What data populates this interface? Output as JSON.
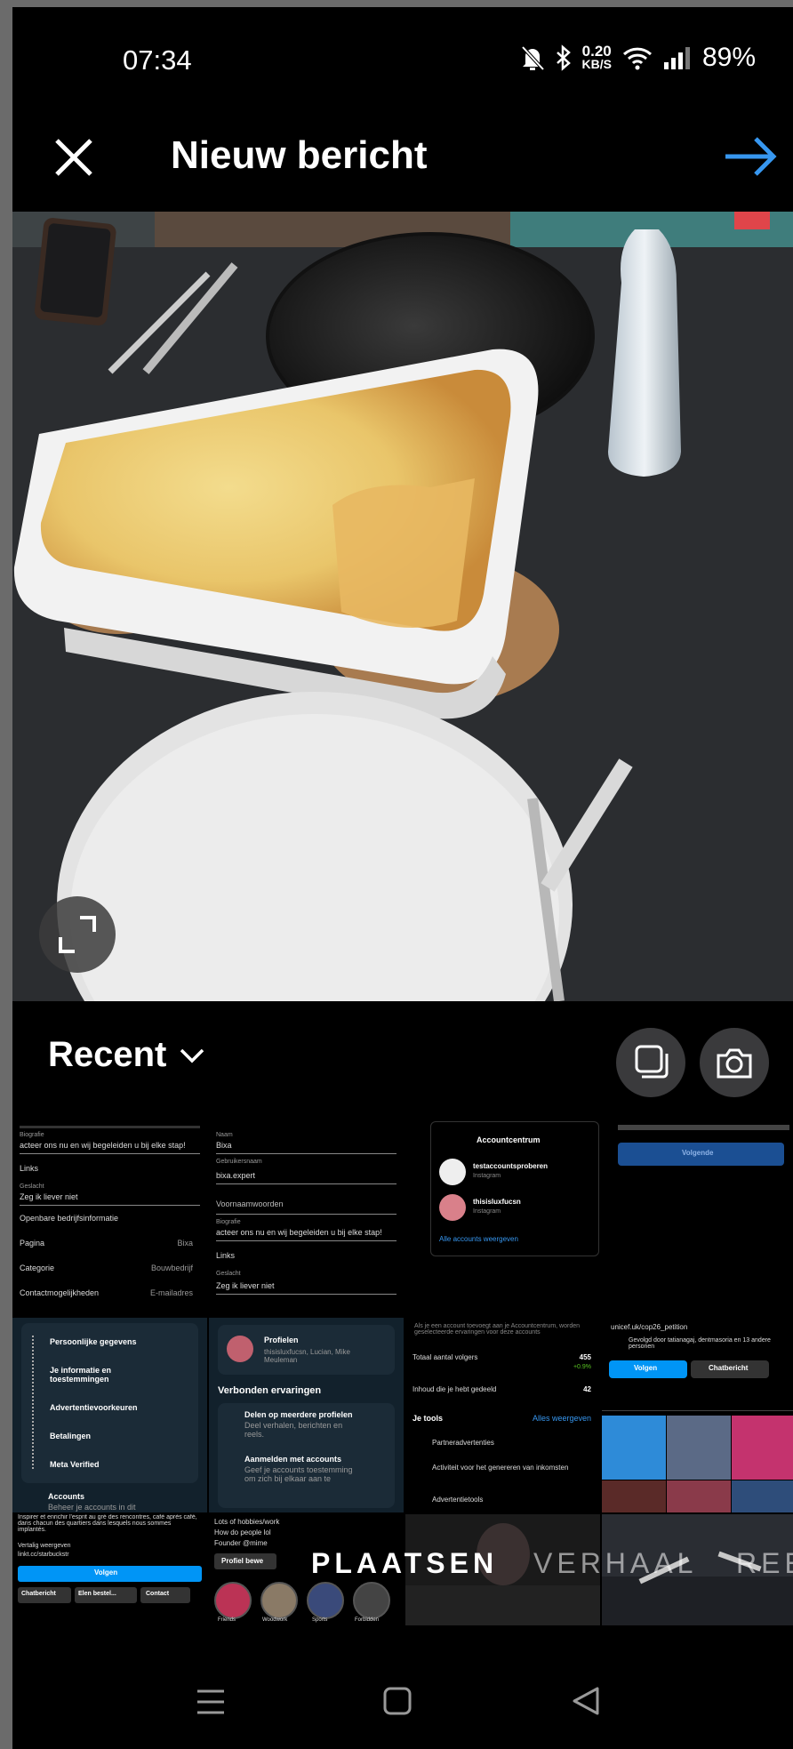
{
  "status": {
    "time": "07:34",
    "speed_value": "0.20",
    "speed_unit": "KB/S",
    "battery": "89%"
  },
  "header": {
    "title": "Nieuw bericht",
    "accent": "#3797f0"
  },
  "gallery": {
    "album": "Recent"
  },
  "thumbs": {
    "t1": {
      "bio_label": "Biografie",
      "bio": "acteer ons nu en wij begeleiden u bij elke stap!",
      "links": "Links",
      "gender_label": "Geslacht",
      "gender": "Zeg ik liever niet",
      "business": "Openbare bedrijfsinformatie",
      "page": "Pagina",
      "page_val": "Bixa",
      "category": "Categorie",
      "category_val": "Bouwbedrijf",
      "contact": "Contactmogelijkheden",
      "contact_val": "E-mailadres"
    },
    "t2": {
      "name_label": "Naam",
      "name": "Bixa",
      "user_label": "Gebruikersnaam",
      "user": "bixa.expert",
      "pronouns": "Voornaamwoorden",
      "bio_label": "Biografie",
      "bio": "acteer ons nu en wij begeleiden u bij elke stap!",
      "links": "Links",
      "gender_label": "Geslacht",
      "gender": "Zeg ik liever niet"
    },
    "t3": {
      "title": "Accountcentrum",
      "acc1": "testaccountsproberen",
      "acc1_sub": "Instagram",
      "acc2": "thisisluxfucsn",
      "acc2_sub": "Instagram",
      "link": "Alle accounts weergeven"
    },
    "t4": {
      "button": "Volgende"
    },
    "t5": {
      "items": [
        "Persoonlijke gegevens",
        "Je informatie en toestemmingen",
        "Advertentievoorkeuren",
        "Betalingen",
        "Meta Verified"
      ],
      "accounts": "Accounts",
      "accounts_sub": "Beheer je accounts in dit"
    },
    "t6": {
      "profiles": "Profielen",
      "profiles_sub": "thisisluxfucsn, Lucian, Mike Meuleman",
      "connected": "Verbonden ervaringen",
      "share": "Delen op meerdere profielen",
      "share_sub": "Deel verhalen, berichten en reels.",
      "login": "Aanmelden met accounts",
      "login_sub": "Geef je accounts toestemming om zich bij elkaar aan te"
    },
    "t7": {
      "note": "Als je een account toevoegt aan je Accountcentrum, worden geselecteerde ervaringen voor deze accounts",
      "followers": "Totaal aantal volgers",
      "followers_val": "455",
      "followers_delta": "+0.9%",
      "content": "Inhoud die je hebt gedeeld",
      "content_val": "42",
      "tools": "Je tools",
      "tools_link": "Alles weergeven",
      "tool1": "Partneradvertenties",
      "tool2": "Activiteit voor het genereren van inkomsten",
      "tool3": "Advertentietools"
    },
    "t8": {
      "link": "unicef.uk/cop26_petition",
      "followed": "Gevolgd door tatianagaj, dentmasoria en 13 andere personen",
      "follow": "Volgen",
      "message": "Chatbericht"
    },
    "t9": {
      "text": "Inspirer et enrichir l'esprit au gré des rencontres, café après café, dans chacun des quartiers dans lesquels nous sommes implantés.",
      "more": "Vertalig weergeven",
      "link": "linkt.cc/starbuckstr",
      "follow": "Volgen",
      "b1": "Chatbericht",
      "b2": "Elen bestel...",
      "b3": "Contact"
    },
    "t10": {
      "text": "Lots of hobbies/work",
      "text2": "How do people lol",
      "text3": "Founder @mime",
      "button": "Profiel bewe",
      "h1": "Friends",
      "h2": "Woodwork",
      "h3": "Sports",
      "h4": "Forbidden"
    }
  },
  "tabs": {
    "active": "PLAATSEN",
    "t2": "VERHAAL",
    "t3": "REEL"
  }
}
